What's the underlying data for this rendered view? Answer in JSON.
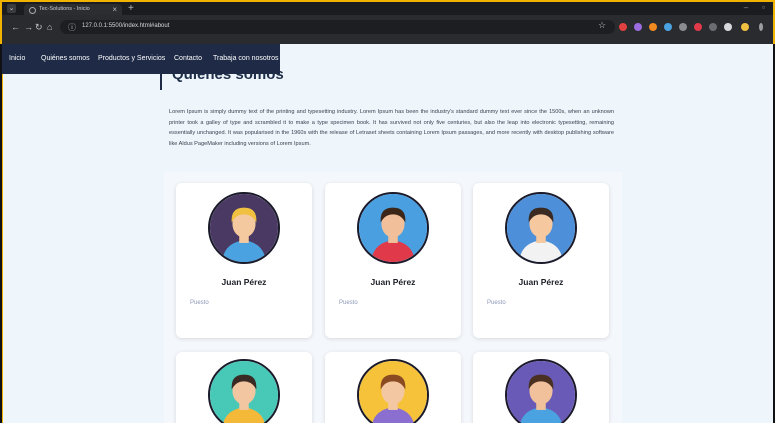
{
  "browser": {
    "tab_title": "Tec-Solutions - Inicio",
    "url": "127.0.0.1:5500/index.html#about"
  },
  "nav": {
    "items": [
      "Inicio",
      "Quiénes somos",
      "Productos y Servicios",
      "Contacto",
      "Trabaja con nosotros"
    ]
  },
  "about": {
    "title": "Quienes somos",
    "paragraph": "Lorem Ipsum is simply dummy text of the printing and typesetting industry. Lorem Ipsum has been the industry's standard dummy text ever since the 1500s, when an unknown printer took a galley of type and scrambled it to make a type specimen book. It has survived not only five centuries, but also the leap into electronic typesetting, remaining essentially unchanged. It was popularised in the 1960s with the release of Letraset sheets containing Lorem Ipsum passages, and more recently with desktop publishing software like Aldus PageMaker including versions of Lorem Ipsum."
  },
  "team": [
    {
      "name": "Juan Pérez",
      "role": "Puesto",
      "bg": "#4a3a63",
      "hair": "#f0c040",
      "shirt": "#4aa3e0",
      "skin": "#f5c9a0"
    },
    {
      "name": "Juan Pérez",
      "role": "Puesto",
      "bg": "#4a9fe0",
      "hair": "#3b2618",
      "shirt": "#e03a4a",
      "skin": "#f1c09a"
    },
    {
      "name": "Juan Pérez",
      "role": "Puesto",
      "bg": "#4d8fd8",
      "hair": "#3a2a22",
      "shirt": "#f2f2f2",
      "skin": "#f5c8a0"
    },
    {
      "name": "",
      "role": "",
      "bg": "#48c9b8",
      "hair": "#3a2a25",
      "shirt": "#f5b93a",
      "skin": "#f2c6a0"
    },
    {
      "name": "",
      "role": "",
      "bg": "#f5c23a",
      "hair": "#8a4a22",
      "shirt": "#8a6fd0",
      "skin": "#f3c7a2"
    },
    {
      "name": "",
      "role": "",
      "bg": "#6a5ab8",
      "hair": "#4a3020",
      "shirt": "#4aa3e0",
      "skin": "#f0c19a"
    }
  ]
}
